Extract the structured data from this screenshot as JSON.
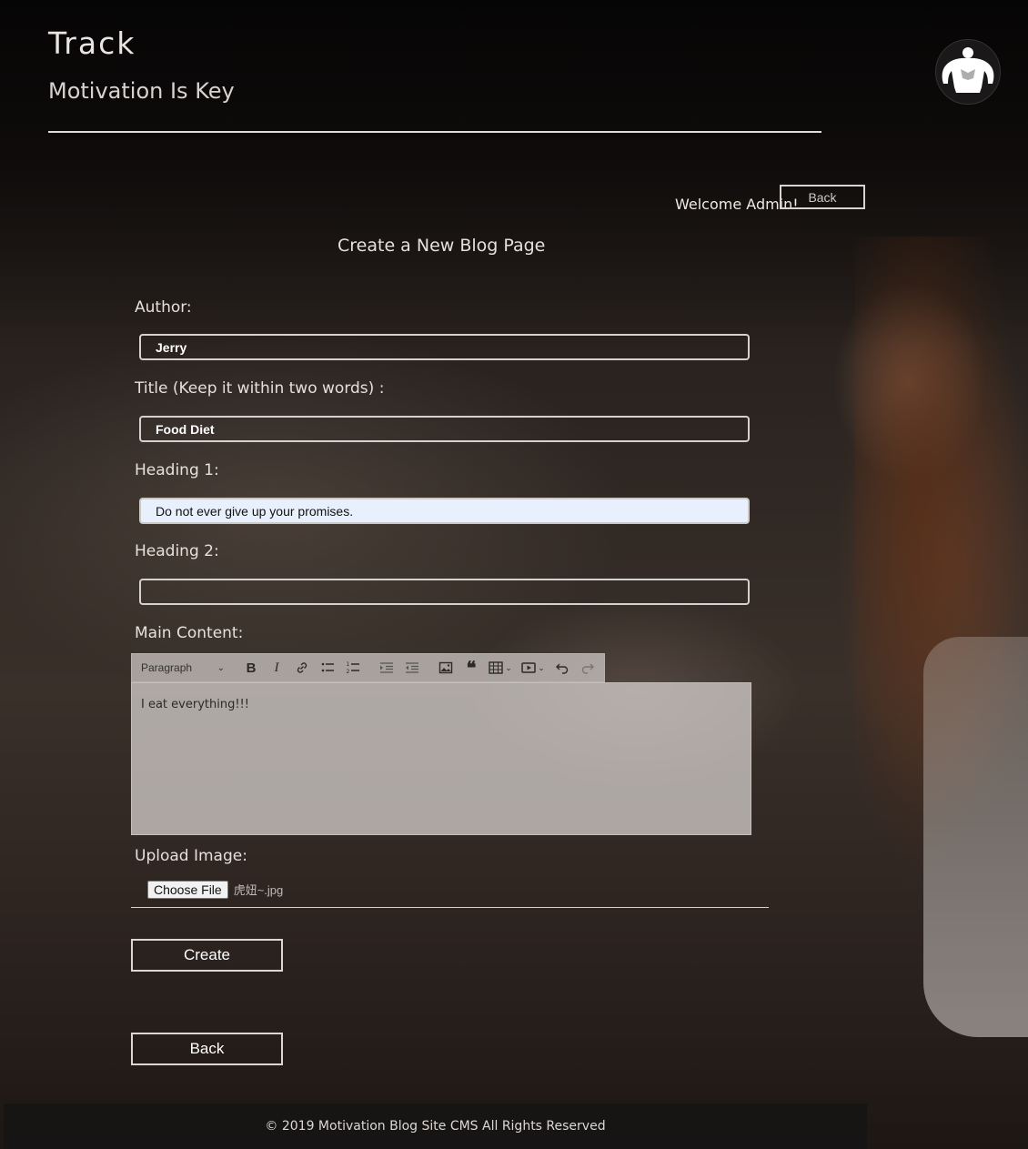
{
  "brand": {
    "title": "Track",
    "tagline": "Motivation Is Key",
    "logo_icon": "bodybuilder-icon"
  },
  "header": {
    "welcome": "Welcome Admin!",
    "back_label": "Back"
  },
  "form": {
    "heading": "Create a New Blog Page",
    "author_label": "Author:",
    "author_value": "Jerry",
    "title_label": "Title (Keep it within two words) :",
    "title_value": "Food Diet",
    "heading1_label": "Heading 1:",
    "heading1_value": "Do not ever give up your promises.",
    "heading2_label": "Heading 2:",
    "heading2_value": "",
    "content_label": "Main Content:",
    "editor": {
      "format_select": "Paragraph",
      "toolbar_icons": [
        "bold-icon",
        "italic-icon",
        "link-icon",
        "bulleted-list-icon",
        "numbered-list-icon",
        "indent-icon",
        "outdent-icon",
        "image-icon",
        "quote-icon",
        "table-icon",
        "media-icon",
        "undo-icon",
        "redo-icon"
      ],
      "content": "I eat everything!!!"
    },
    "upload_label": "Upload Image:",
    "choose_file_label": "Choose File",
    "file_name": "虎妞~.jpg",
    "create_label": "Create",
    "back_label": "Back"
  },
  "footer": {
    "text": "© 2019 Motivation Blog Site CMS All Rights Reserved"
  }
}
